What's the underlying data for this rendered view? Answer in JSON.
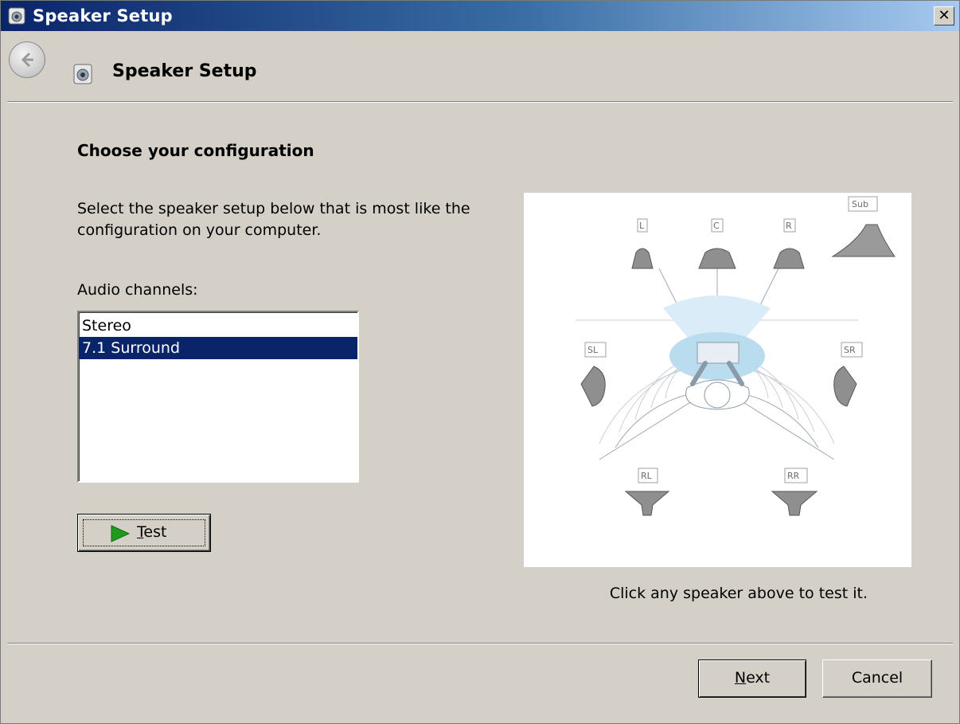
{
  "window": {
    "title": "Speaker Setup",
    "close_glyph": "✕"
  },
  "nav": {
    "title": "Speaker Setup",
    "back_icon": "back-arrow-icon",
    "page_icon": "speaker-icon"
  },
  "main": {
    "heading": "Choose your configuration",
    "instructions": "Select the speaker setup below that is most like the configuration on your computer.",
    "channels_label": "Audio channels:",
    "channels": [
      {
        "label": "Stereo",
        "selected": false
      },
      {
        "label": "7.1 Surround",
        "selected": true
      }
    ],
    "test_button": {
      "label_underlined": "T",
      "label_rest": "est",
      "icon": "play-icon"
    }
  },
  "diagram": {
    "caption": "Click any speaker above to test it.",
    "speakers": {
      "left": "L",
      "center": "C",
      "right": "R",
      "sub": "Sub",
      "side_left": "SL",
      "side_right": "SR",
      "rear_left": "RL",
      "rear_right": "RR"
    }
  },
  "footer": {
    "next_underlined": "N",
    "next_rest": "ext",
    "cancel": "Cancel"
  },
  "colors": {
    "selection": "#0a246a",
    "titlebar_start": "#0a246a",
    "titlebar_end": "#a6caf0",
    "dialog_bg": "#d4d0c8",
    "play_green": "#1e9b1e"
  }
}
